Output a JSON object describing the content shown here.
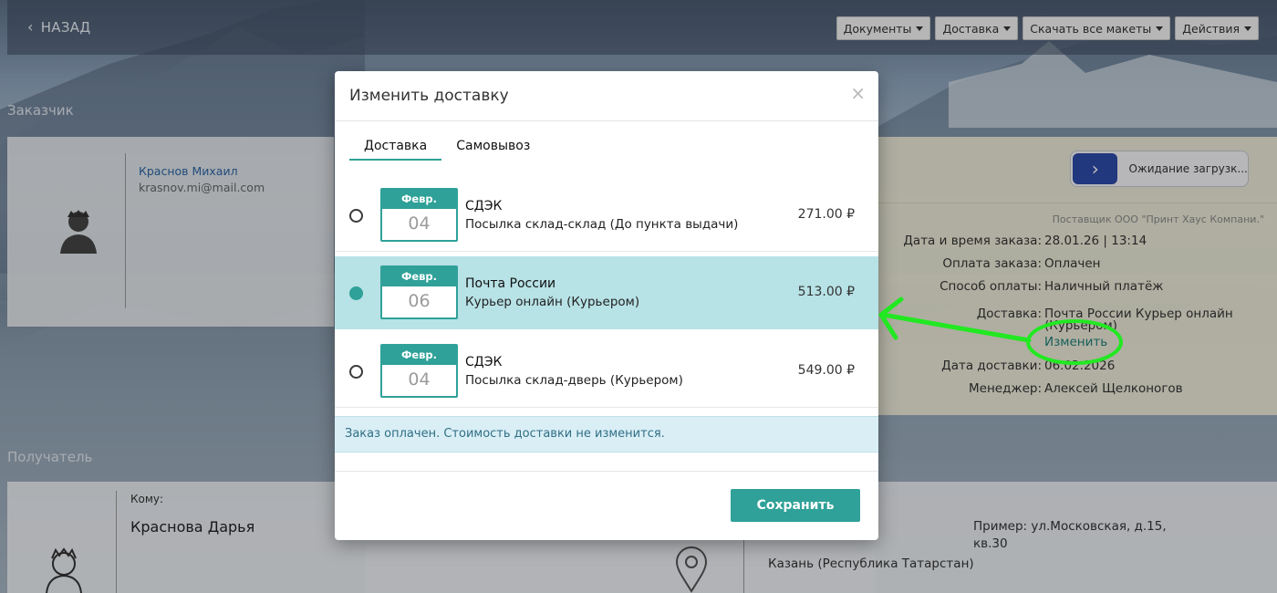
{
  "topbar": {
    "back_label": "НАЗАД",
    "buttons": [
      "Документы",
      "Доставка",
      "Скачать все макеты",
      "Действия"
    ]
  },
  "sections": {
    "customer_title": "Заказчик",
    "recipient_title": "Получатель"
  },
  "customer": {
    "name": "Краснов Михаил",
    "email": "krasnov.mi@mail.com"
  },
  "order_info": {
    "status": "Ожидание загрузк...",
    "supplier": "Поставщик ООО \"Принт Хаус Компани.\"",
    "rows": [
      {
        "label": "Дата и время заказа:",
        "value": "28.01.26 | 13:14"
      },
      {
        "label": "Оплата заказа:",
        "value": "Оплачен"
      },
      {
        "label": "Способ оплаты:",
        "value": "Наличный платёж"
      },
      {
        "label": "Доставка:",
        "value": "Почта России Курьер онлайн"
      },
      {
        "label": "Дата доставки:",
        "value": "06.02.2026"
      },
      {
        "label": "Менеджер:",
        "value": "Алексей Щелконогов"
      }
    ],
    "delivery_continuation": "(Курьером)",
    "change_link": "Изменить"
  },
  "recipient": {
    "to_label": "Кому:",
    "name": "Краснова Дарья",
    "address_example": "Пример: ул.Московская, д.15, кв.30",
    "city": "Казань (Республика Татарстан)"
  },
  "modal": {
    "title": "Изменить доставку",
    "close_glyph": "×",
    "tabs": [
      {
        "label": "Доставка",
        "active": true
      },
      {
        "label": "Самовывоз",
        "active": false
      }
    ],
    "options": [
      {
        "month": "Февр.",
        "day": "04",
        "carrier": "СДЭК",
        "service": "Посылка склад-склад (До пункта выдачи)",
        "price": "271.00 ₽",
        "selected": false
      },
      {
        "month": "Февр.",
        "day": "06",
        "carrier": "Почта России",
        "service": "Курьер онлайн (Курьером)",
        "price": "513.00 ₽",
        "selected": true
      },
      {
        "month": "Февр.",
        "day": "04",
        "carrier": "СДЭК",
        "service": "Посылка склад-дверь (Курьером)",
        "price": "549.00 ₽",
        "selected": false
      }
    ],
    "notice": "Заказ оплачен. Стоимость доставки не изменится.",
    "save_label": "Сохранить"
  },
  "colors": {
    "accent": "#2fa198",
    "selected_row": "#b7e2e6",
    "notice_bg": "#daeef5",
    "annotation": "#22e822"
  }
}
